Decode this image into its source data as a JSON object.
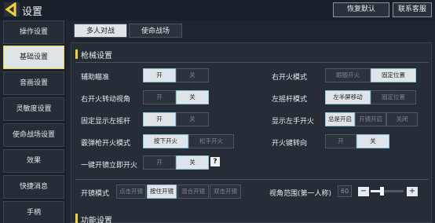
{
  "header": {
    "title": "设置",
    "reset_label": "恢复默认",
    "support_label": "联系客服"
  },
  "sidebar": {
    "items": [
      {
        "label": "操作设置"
      },
      {
        "label": "基础设置",
        "active": true
      },
      {
        "label": "音画设置"
      },
      {
        "label": "灵敏度设置"
      },
      {
        "label": "使命战场设置"
      },
      {
        "label": "效果"
      },
      {
        "label": "快捷消息"
      },
      {
        "label": "手柄"
      }
    ]
  },
  "tabs": [
    {
      "label": "多人对战",
      "active": true
    },
    {
      "label": "使命战场",
      "active": false
    }
  ],
  "section": {
    "title": "枪械设置"
  },
  "settings": {
    "aim_assist": {
      "label": "辅助瞄准",
      "options": [
        "开",
        "关"
      ],
      "selected": 0
    },
    "ads_turn": {
      "label": "右开火转动视角",
      "options": [
        "开",
        "关"
      ],
      "selected": 1
    },
    "show_left_stick": {
      "label": "固定显示左摇杆",
      "options": [
        "开",
        "关"
      ],
      "selected": 0
    },
    "shotgun_fire": {
      "label": "霰弹枪开火模式",
      "options": [
        "按下开火",
        "松手开火"
      ],
      "selected": 0
    },
    "quick_scope": {
      "label": "一键开镜立即开火",
      "options": [
        "开",
        "关"
      ],
      "selected": 1,
      "help": "?"
    },
    "right_fire_mode": {
      "label": "右开火模式",
      "options": [
        "跟随开火",
        "固定位置"
      ],
      "selected": 1
    },
    "left_stick_mode": {
      "label": "左摇杆模式",
      "options": [
        "左半屏移动",
        "固定位置"
      ],
      "selected": 0
    },
    "show_left_fire": {
      "label": "显示左手开火",
      "options": [
        "总是开启",
        "开镜开启",
        "关闭"
      ],
      "selected": 0
    },
    "fire_key_turn": {
      "label": "开火键转向",
      "options": [
        "开",
        "关"
      ],
      "selected": 1
    },
    "scope_mode": {
      "label": "开镜模式",
      "options": [
        "点击开镜",
        "按住开镜",
        "混合开镜",
        "双击开镜"
      ],
      "selected": 1
    },
    "fov": {
      "label": "视角范围(第一人称)",
      "value": "60",
      "minus": "−",
      "plus": "+",
      "level": 0.3
    }
  },
  "section2": {
    "title": "功能设置"
  },
  "colors": {
    "accent": "#f3d13a",
    "selected_bg": "#dfe4e8",
    "panel_bg": "#262d36"
  }
}
